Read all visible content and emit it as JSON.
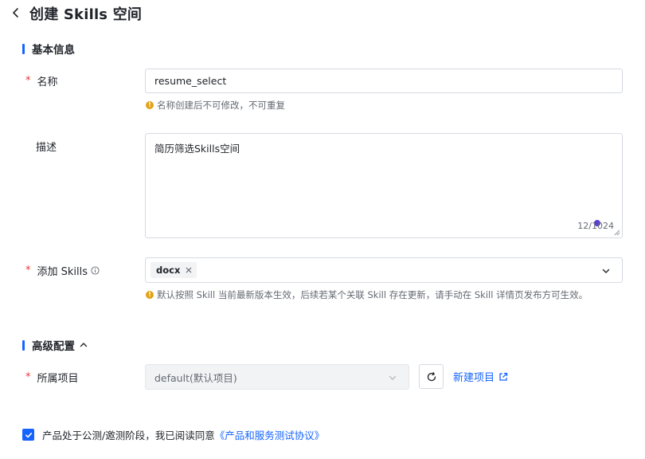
{
  "header": {
    "title": "创建 Skills 空间",
    "back_icon": "chevron-left-icon"
  },
  "basic": {
    "section_title": "基本信息",
    "name": {
      "label": "名称",
      "required_mark": "*",
      "value": "resume_select",
      "hint": "名称创建后不可修改，不可重复"
    },
    "description": {
      "label": "描述",
      "value": "简历筛选Skills空间",
      "counter": "12/1024"
    },
    "skills": {
      "label": "添加 Skills",
      "required_mark": "*",
      "info_icon": "info-circle-icon",
      "tags": [
        "docx"
      ],
      "hint": "默认按照 Skill 当前最新版本生效，后续若某个关联 Skill 存在更新，请手动在 Skill 详情页发布方可生效。"
    }
  },
  "advanced": {
    "section_title": "高级配置",
    "toggle_icon": "chevron-up-icon",
    "project": {
      "label": "所属项目",
      "required_mark": "*",
      "value": "default(默认项目)",
      "refresh_icon": "refresh-icon",
      "new_link": "新建项目",
      "external_icon": "external-link-icon"
    }
  },
  "agreement": {
    "checked": true,
    "text": "产品处于公测/邀测阶段，我已阅读同意",
    "link": "《产品和服务测试协议》"
  },
  "colors": {
    "primary": "#1664ff",
    "required": "#e53935",
    "warning": "#e2a117"
  }
}
